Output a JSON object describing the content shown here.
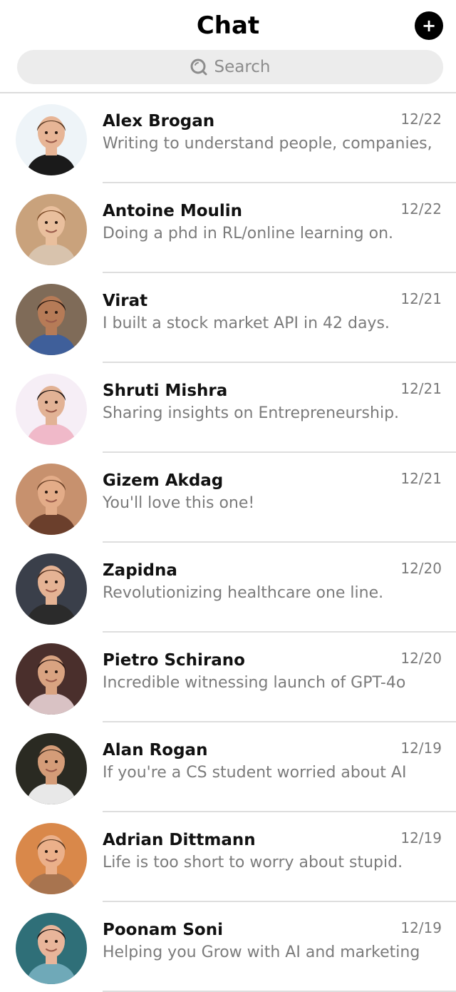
{
  "header": {
    "title": "Chat",
    "add_button_label": "+",
    "search_placeholder": "Search"
  },
  "chats": [
    {
      "name": "Alex Brogan",
      "date": "12/22",
      "preview": "Writing to understand people, companies,",
      "avatar": {
        "bg": "#eef4f8",
        "skin": "#e7b596",
        "hair": "#5a3a24",
        "shirt": "#1a1a1a"
      }
    },
    {
      "name": "Antoine Moulin",
      "date": "12/22",
      "preview": "Doing a phd in RL/online learning on.",
      "avatar": {
        "bg": "#c9a27c",
        "skin": "#e9bf9d",
        "hair": "#7a4a26",
        "shirt": "#d8c3ad"
      }
    },
    {
      "name": "Virat",
      "date": "12/21",
      "preview": "I built a stock market API in 42 days.",
      "avatar": {
        "bg": "#7f6b58",
        "skin": "#b67b57",
        "hair": "#2a1a12",
        "shirt": "#3f5f9a"
      }
    },
    {
      "name": "Shruti Mishra",
      "date": "12/21",
      "preview": "Sharing insights on Entrepreneurship.",
      "avatar": {
        "bg": "#f6eef6",
        "skin": "#e2b295",
        "hair": "#1c1412",
        "shirt": "#f0b9c9"
      }
    },
    {
      "name": "Gizem Akdag",
      "date": "12/21",
      "preview": "You'll love this one!",
      "avatar": {
        "bg": "#c7916e",
        "skin": "#e3ac88",
        "hair": "#6b4228",
        "shirt": "#6b3f2c"
      }
    },
    {
      "name": "Zapidna",
      "date": "12/20",
      "preview": "Revolutionizing healthcare one line.",
      "avatar": {
        "bg": "#3a3f4a",
        "skin": "#e5b394",
        "hair": "#4a2a1a",
        "shirt": "#2b2b2b"
      }
    },
    {
      "name": "Pietro Schirano",
      "date": "12/20",
      "preview": "Incredible witnessing launch of GPT-4o",
      "avatar": {
        "bg": "#4a2f2c",
        "skin": "#d9a381",
        "hair": "#2a1612",
        "shirt": "#d9c2c4"
      }
    },
    {
      "name": "Alan Rogan",
      "date": "12/19",
      "preview": "If you're a CS student worried about AI",
      "avatar": {
        "bg": "#2a2a22",
        "skin": "#d49c78",
        "hair": "#3a281c",
        "shirt": "#e8e8e8"
      }
    },
    {
      "name": "Adrian Dittmann",
      "date": "12/19",
      "preview": "Life is too short to worry about stupid.",
      "avatar": {
        "bg": "#d9884a",
        "skin": "#ebb08a",
        "hair": "#5a3a22",
        "shirt": "#a8744f"
      }
    },
    {
      "name": "Poonam Soni",
      "date": "12/19",
      "preview": "Helping you Grow with AI and marketing",
      "avatar": {
        "bg": "#2f6f78",
        "skin": "#e8b59a",
        "hair": "#1a1414",
        "shirt": "#6fa9b8"
      }
    }
  ]
}
